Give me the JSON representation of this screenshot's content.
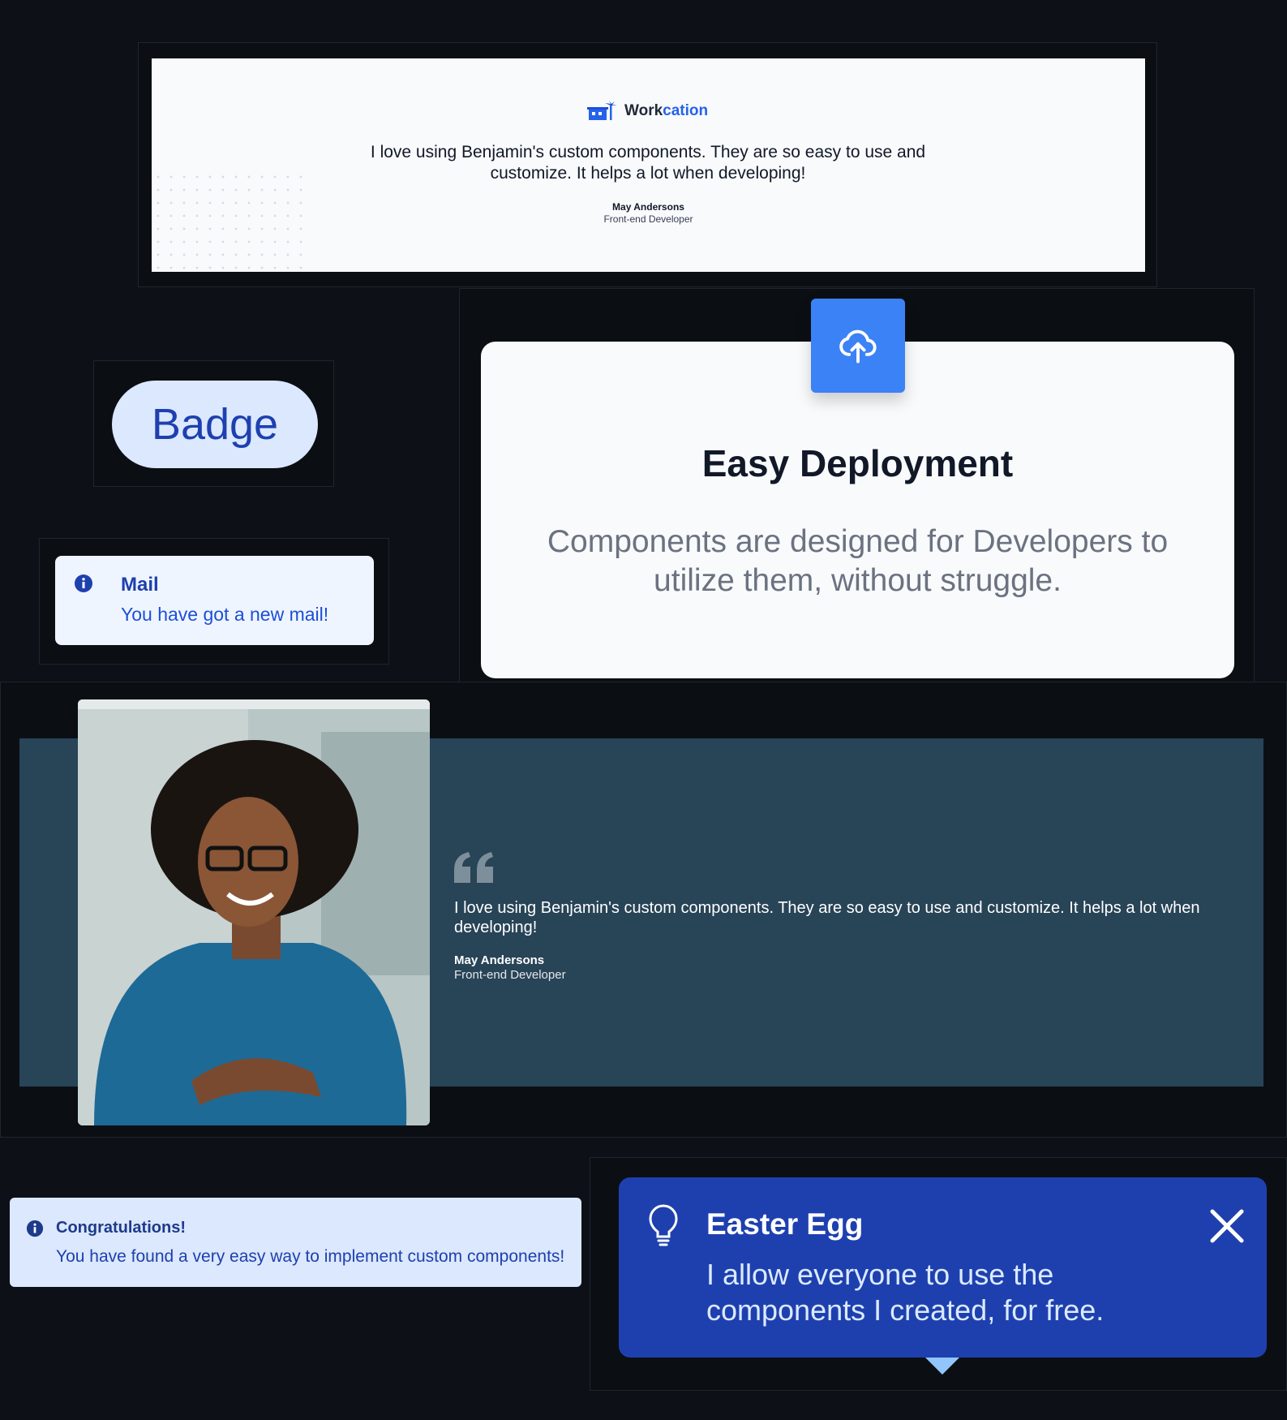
{
  "testimonial1": {
    "logo_word": "Work",
    "logo_accent": "cation",
    "quote": "I love using Benjamin's custom components. They are so easy to use and customize. It helps a lot when developing!",
    "author": "May Andersons",
    "role": "Front-end Developer"
  },
  "badge": {
    "label": "Badge"
  },
  "mail_alert": {
    "title": "Mail",
    "message": "You have got a new mail!"
  },
  "deploy_card": {
    "icon": "cloud-upload-icon",
    "title": "Easy Deployment",
    "description": "Components are designed for Developers to utilize them, without struggle."
  },
  "testimonial2": {
    "quote": "I love using Benjamin's custom components. They are so easy to use and customize. It helps a lot when developing!",
    "author": "May Andersons",
    "role": "Front-end Developer"
  },
  "congrats_alert": {
    "title": "Congratulations!",
    "message": "You have found a very easy way to implement custom components!"
  },
  "easter_egg": {
    "title": "Easter Egg",
    "message": "I allow everyone to use the components I created, for free."
  },
  "colors": {
    "page_background": "#0d1117",
    "accent_blue": "#3b82f6",
    "badge_bg": "#dbe8fe",
    "badge_text": "#1e40af",
    "testimonial_banner": "#284457",
    "toast_bg": "#1e40af"
  }
}
